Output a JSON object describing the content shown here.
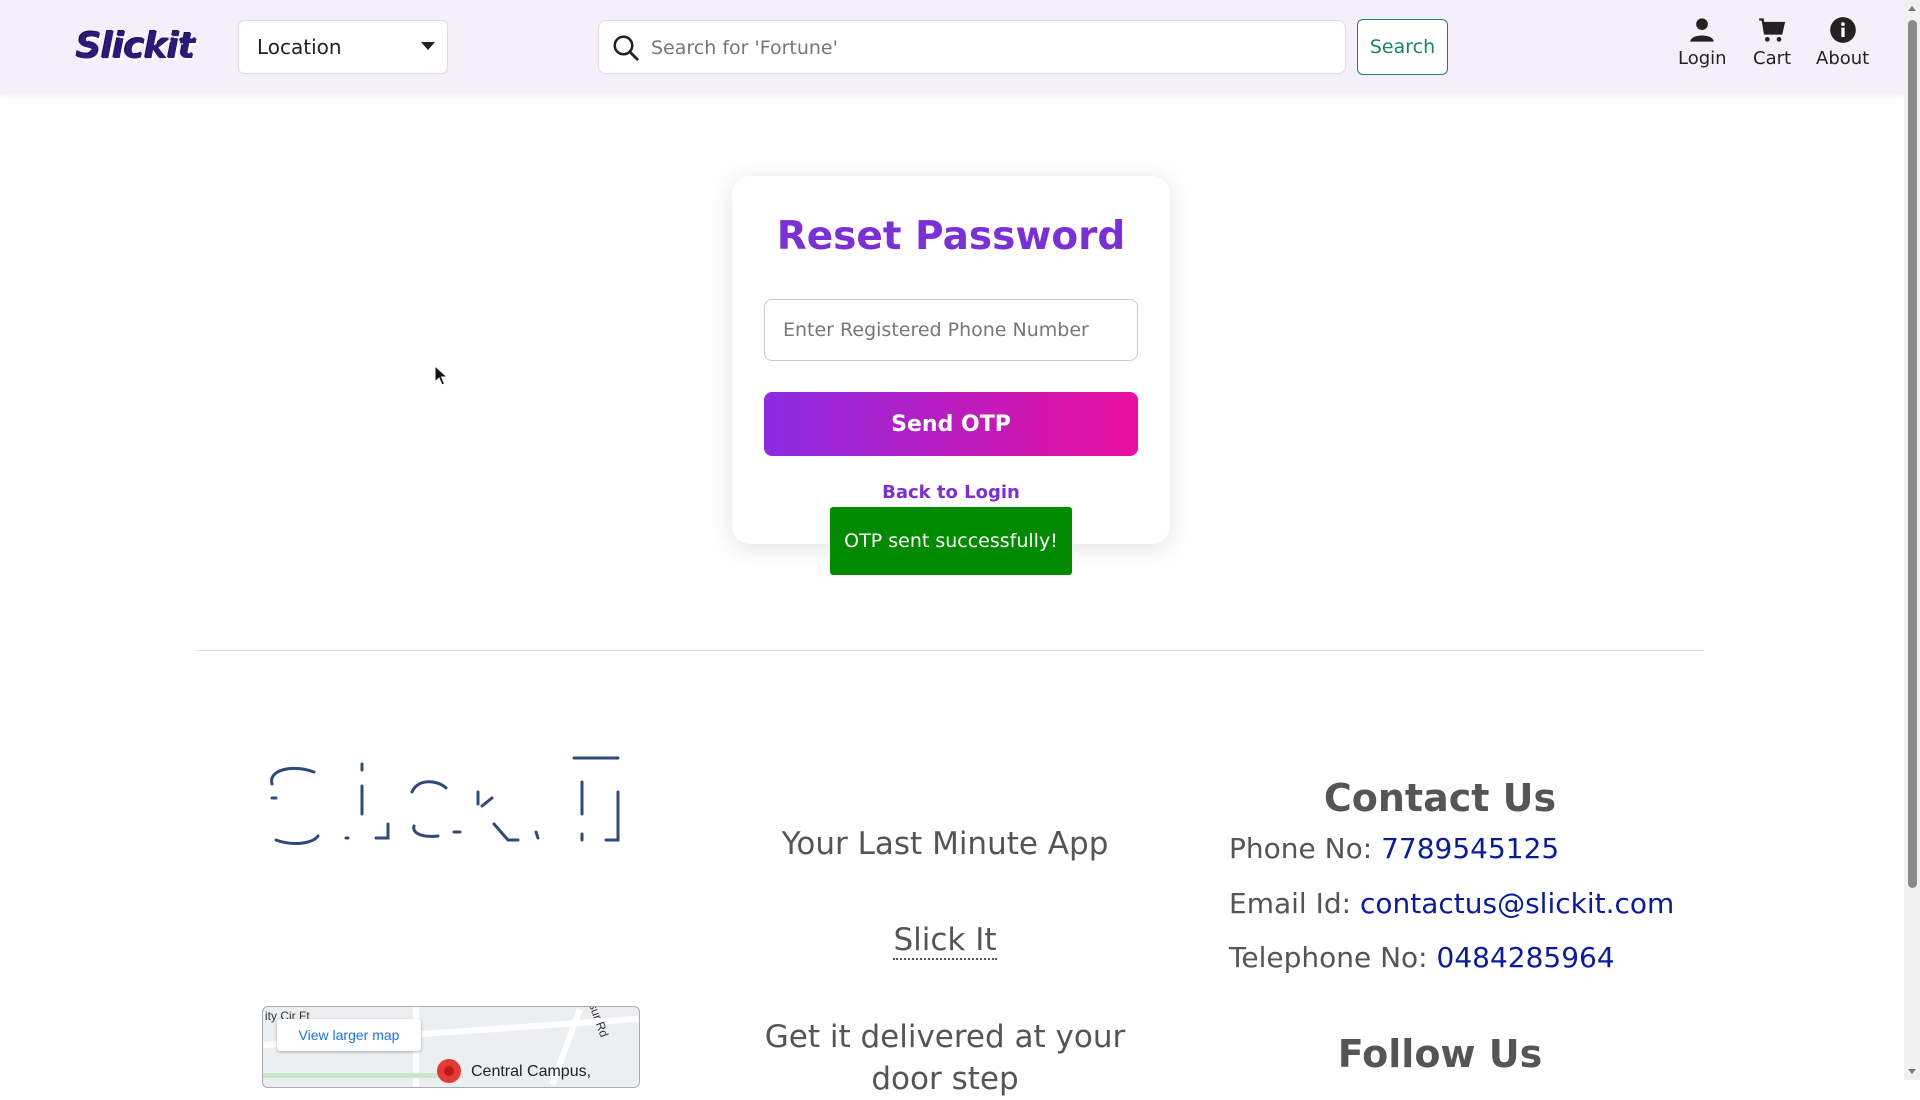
{
  "header": {
    "logo": "Slickit",
    "location_label": "Location",
    "search_placeholder": "Search for 'Fortune'",
    "search_button": "Search",
    "nav": [
      {
        "label": "Login",
        "icon": "user-icon"
      },
      {
        "label": "Cart",
        "icon": "cart-icon"
      },
      {
        "label": "About",
        "icon": "info-icon"
      }
    ]
  },
  "reset_card": {
    "title": "Reset Password",
    "phone_placeholder": "Enter Registered Phone Number",
    "send_button": "Send OTP",
    "back_link": "Back to Login"
  },
  "toast": {
    "message": "OTP sent successfully!",
    "color": "#008a00"
  },
  "footer": {
    "tagline": "Your Last Minute App",
    "brand_link": "Slick It",
    "delivery_text": "Get it delivered at your door step",
    "contact": {
      "title": "Contact Us",
      "phone_label": "Phone No:",
      "phone_value": "7789545125",
      "email_label": "Email Id:",
      "email_value": "contactus@slickit.com",
      "telephone_label": "Telephone No:",
      "telephone_value": "0484285964"
    },
    "follow_title": "Follow Us",
    "map": {
      "button": "View larger map",
      "place": "Central Campus,",
      "street_1": "ity Cir Ft",
      "street_2": "sur Rd"
    }
  },
  "colors": {
    "brand_purple": "#7a2fd8",
    "gradient_start": "#8a2be2",
    "gradient_end": "#ea0f9d",
    "search_green": "#198754",
    "link_blue": "#0a1aa0"
  }
}
